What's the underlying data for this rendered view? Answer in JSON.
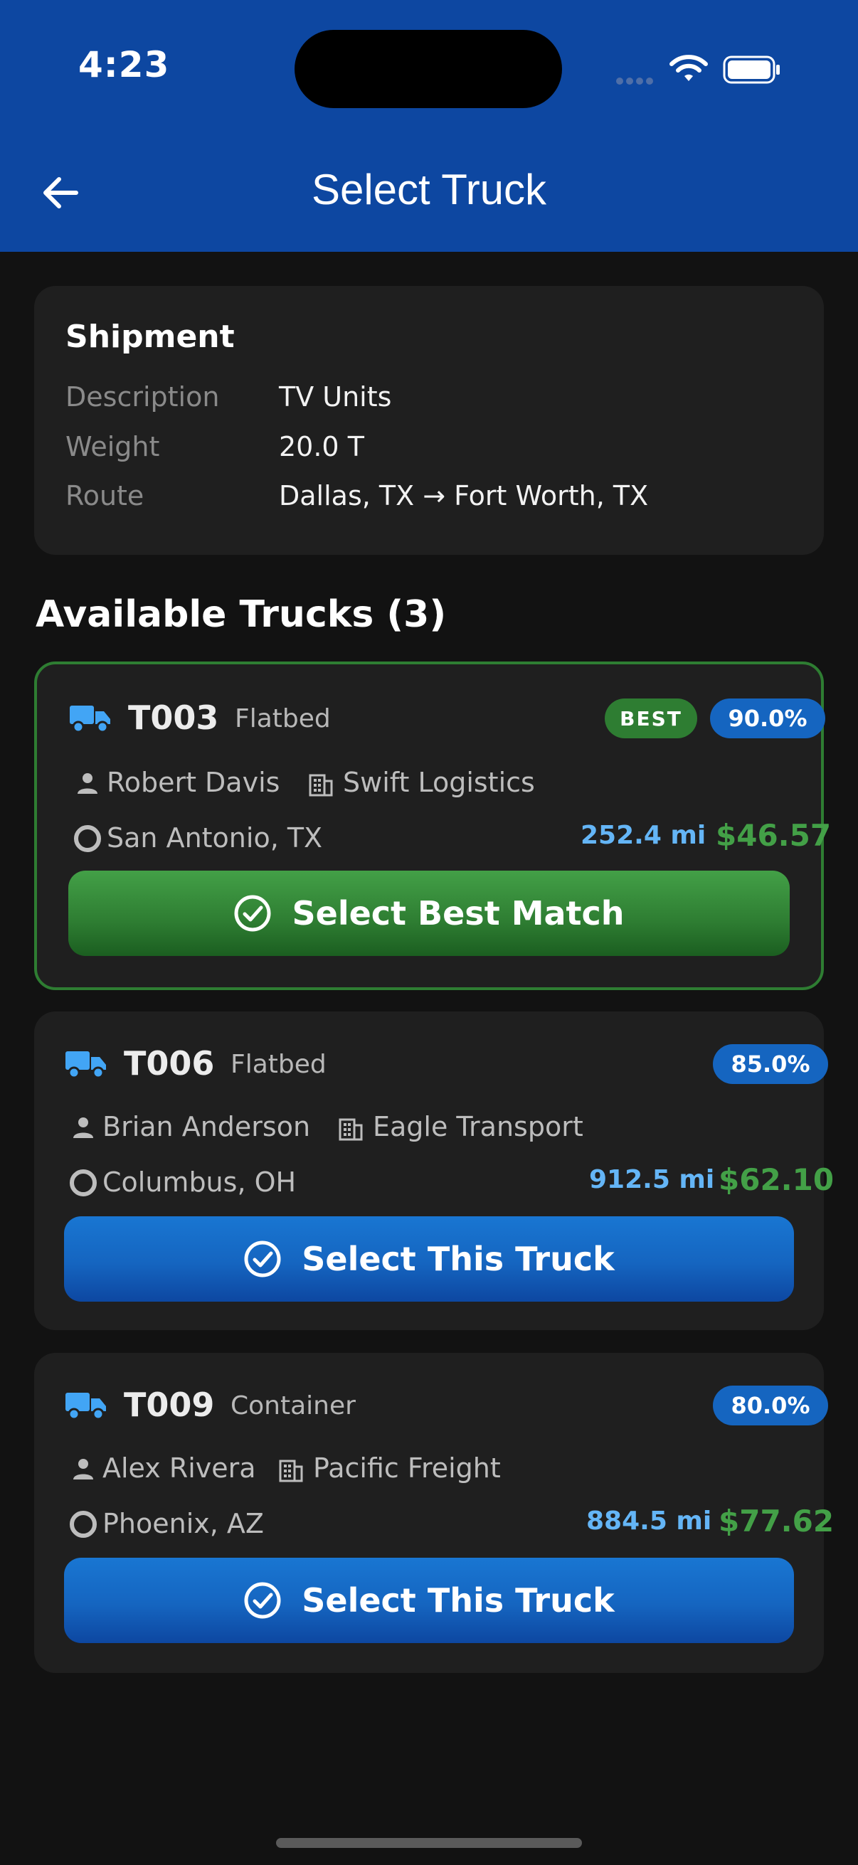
{
  "status_bar": {
    "time": "4:23"
  },
  "header": {
    "title": "Select Truck"
  },
  "shipment": {
    "heading": "Shipment",
    "rows": [
      {
        "label": "Description",
        "value": "TV Units"
      },
      {
        "label": "Weight",
        "value": "20.0 T"
      },
      {
        "label": "Route",
        "value": "Dallas, TX → Fort Worth, TX"
      }
    ]
  },
  "available": {
    "heading": "Available Trucks (3)"
  },
  "trucks": [
    {
      "id": "T003",
      "type": "Flatbed",
      "best_badge": "BEST",
      "score": "90.0%",
      "driver": "Robert Davis",
      "company": "Swift Logistics",
      "location": "San Antonio, TX",
      "distance": "252.4 mi",
      "price": "$46.57",
      "button_label": "Select Best Match"
    },
    {
      "id": "T006",
      "type": "Flatbed",
      "score": "85.0%",
      "driver": "Brian Anderson",
      "company": "Eagle Transport",
      "location": "Columbus, OH",
      "distance": "912.5 mi",
      "price": "$62.10",
      "button_label": "Select This Truck"
    },
    {
      "id": "T009",
      "type": "Container",
      "score": "80.0%",
      "driver": "Alex Rivera",
      "company": "Pacific Freight",
      "location": "Phoenix, AZ",
      "distance": "884.5 mi",
      "price": "$77.62",
      "button_label": "Select This Truck"
    }
  ],
  "colors": {
    "header_bg": "#0d47a1",
    "best_border": "#2e7d32",
    "distance": "#64b5f6",
    "price": "#43a047",
    "truck_icon": "#42a5f5"
  }
}
